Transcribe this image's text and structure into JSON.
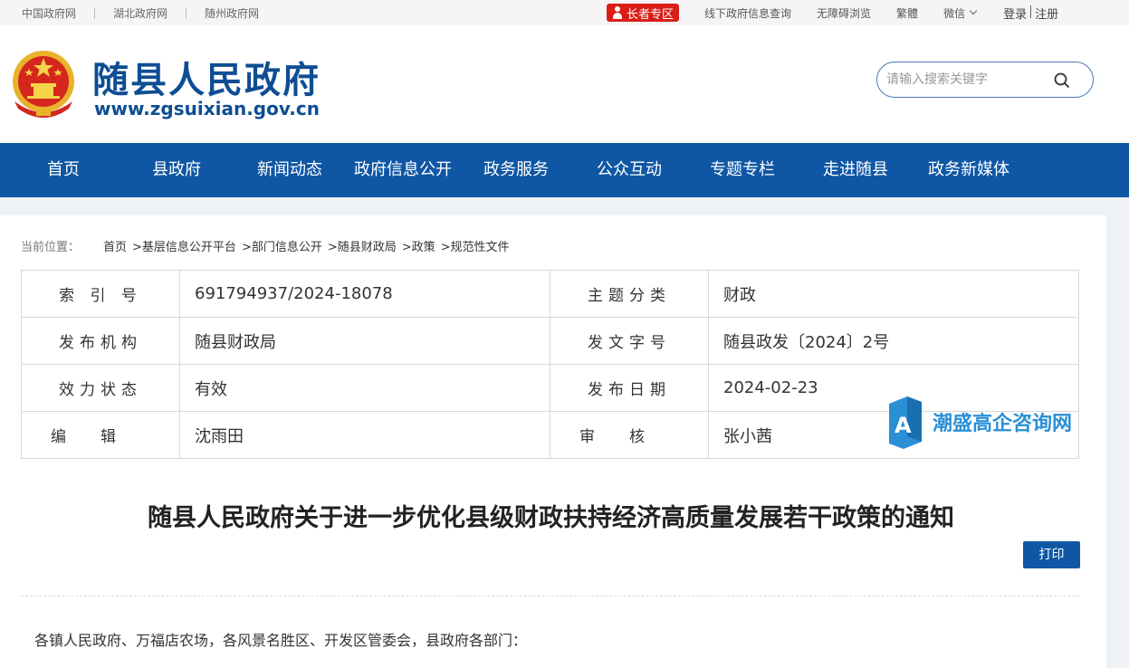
{
  "topbar": {
    "links": [
      "中国政府网",
      "湖北政府网",
      "随州政府网"
    ],
    "elder_zone": "长者专区",
    "offline_query": "线下政府信息查询",
    "accessibility": "无障碍浏览",
    "traditional": "繁體",
    "wechat": "微信",
    "login": "登录",
    "register": "注册"
  },
  "header": {
    "title": "随县人民政府",
    "url": "www.zgsuixian.gov.cn",
    "search_placeholder": "请输入搜索关键字"
  },
  "nav": {
    "items": [
      "首页",
      "县政府",
      "新闻动态",
      "政府信息公开",
      "政务服务",
      "公众互动",
      "专题专栏",
      "走进随县",
      "政务新媒体"
    ]
  },
  "breadcrumb": {
    "lead": "当前位置：",
    "items": [
      "首页",
      ">基层信息公开平台",
      ">部门信息公开",
      ">随县财政局",
      ">政策",
      ">规范性文件"
    ]
  },
  "meta": {
    "rows": [
      {
        "l1": "索 引 号",
        "v1": "691794937/2024-18078",
        "l2": "主题分类",
        "v2": "财政"
      },
      {
        "l1": "发布机构",
        "v1": "随县财政局",
        "l2": "发文字号",
        "v2": "随县政发〔2024〕2号"
      },
      {
        "l1": "效力状态",
        "v1": "有效",
        "l2": "发布日期",
        "v2": "2024-02-23"
      },
      {
        "l1": "编辑",
        "v1": "沈雨田",
        "l2": "审核",
        "v2": "张小茜"
      }
    ]
  },
  "document": {
    "title": "随县人民政府关于进一步优化县级财政扶持经济高质量发展若干政策的通知",
    "print": "打印",
    "salutation": "各镇人民政府、万福店农场，各风景名胜区、开发区管委会，县政府各部门："
  },
  "watermark": {
    "text": "潮盛高企咨询网",
    "logo_letter": "A"
  },
  "colors": {
    "brand_blue": "#0f57a4",
    "title_blue": "#0e4d94",
    "elder_red": "#d91e18",
    "watermark_blue": "#2b8fd6"
  }
}
